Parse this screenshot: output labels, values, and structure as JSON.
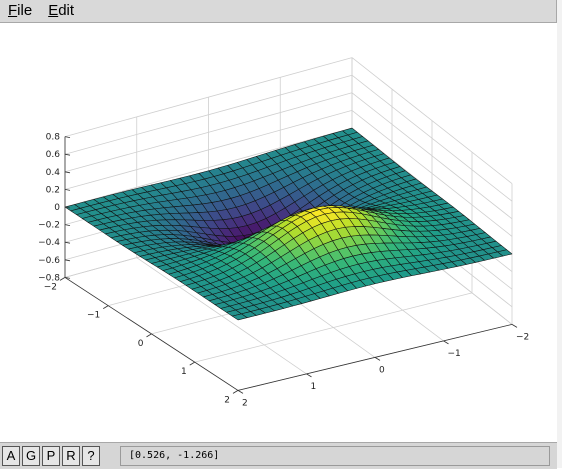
{
  "menu": {
    "file_label": "File",
    "file_mnemonic": "F",
    "file_rest": "ile",
    "edit_label": "Edit",
    "edit_mnemonic": "E",
    "edit_rest": "dit"
  },
  "toolbar": {
    "buttons": [
      "A",
      "G",
      "P",
      "R",
      "?"
    ]
  },
  "status": {
    "coordinates": "[0.526, -1.266]"
  },
  "colors": {
    "menubar": "#d9d9d9",
    "colormap_low": "#440154",
    "colormap_mid": "#21918c",
    "colormap_high": "#fde725"
  },
  "chart_data": {
    "type": "surface",
    "function": "z = x * exp(-x^2 - y^2)",
    "x_range": [
      -2,
      2
    ],
    "y_range": [
      -2,
      2
    ],
    "z_range": [
      -0.8,
      0.8
    ],
    "x_ticks": [
      "−2",
      "−1",
      "0",
      "1",
      "2"
    ],
    "y_ticks": [
      "−2",
      "−1",
      "0",
      "1",
      "2"
    ],
    "z_ticks": [
      "0.8",
      "0.6",
      "0.4",
      "0.2",
      "0",
      "−0.2",
      "−0.4",
      "−0.6",
      "−0.8"
    ],
    "grid": true,
    "colormap": "viridis",
    "grid_resolution": 30
  }
}
